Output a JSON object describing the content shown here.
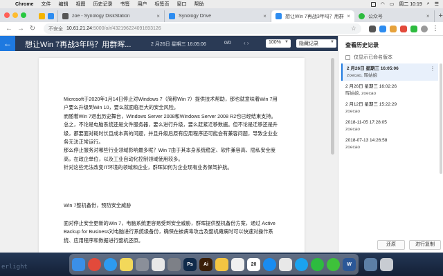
{
  "menubar": {
    "app_name": "Chrome",
    "items": [
      "文件",
      "编辑",
      "视图",
      "历史记录",
      "书签",
      "用户",
      "标签页",
      "窗口",
      "帮助"
    ],
    "clock": "周二 10:19"
  },
  "tabs": [
    {
      "title": "zoe - Synology DiskStation",
      "active": false
    },
    {
      "title": "Synology Drive",
      "active": false
    },
    {
      "title": "想让Win 7再战3年吗？用群晖让",
      "active": true
    },
    {
      "title": "公众号",
      "active": false
    }
  ],
  "address": {
    "security_label": "不安全",
    "host": "10.61.21.24",
    "path": ":5000/o/r/432196224091693126"
  },
  "doc": {
    "title": "想让Win 7再战3年吗？用群晖...",
    "date": "2 月26日 星期三 16:05:06",
    "page_indicator": "0/0",
    "zoom": "100%",
    "hide_option": "隐藏记录",
    "paragraphs": [
      "Microsoft于2020年1月14日停止对Windows 7（简称Win 7）提供技术帮助，那也就意味着Win 7用户要么升级到Win 10，要么就面临巨大的安全风险。",
      "而随着Win 7退出历史舞台，Windows Server 2008和Windows Server 2008 R2也已经结束支持。",
      "总之，不论是电脑系统还是文件服务器，要么进行升级，要么赶紧迁移数据。但不论是迁移还是升级，都要面对耗时长且成本高的问题，并且升级后原有应用程序还可能会有兼容问题，导致企业业务无法正常运行。",
      "那么停止服务对哪些行业领域影响最多呢？Win 7由于其本身系统稳定、软件兼容高、隐私安全度高，在政企单位，以及工业自动化控制领域使用较多。",
      "针对这些无法改变IT环境的领域和企业，群晖如何为企业现有业务保驾护航。"
    ],
    "section_heading": "Win 7整机备份，预防安全威胁",
    "section_paragraph": "面对停止安全更新的Win 7，电脑系统更容易受到安全威胁，群晖提供整机备份方案，通过 Active Backup for Business对电脑进行系统级备份，确保在被病毒攻击及整机瘫痪时可以快速对操作系统、应用程序和数据进行整机还原。"
  },
  "history": {
    "title": "查看历史记录",
    "only_named_label": "仅显示已命名版本",
    "entries": [
      {
        "date": "2 月26日 星期三 16:05:06",
        "authors": "zoecao, 晖姑娘",
        "selected": true
      },
      {
        "date": "2 月26日 星期三 16:02:26",
        "authors": "晖姑娘, zoecao",
        "selected": false
      },
      {
        "date": "2 月12日 星期三 15:22:29",
        "authors": "zoecao",
        "selected": false
      },
      {
        "date": "2018-11-05 17:28:05",
        "authors": "zoecao",
        "selected": false
      },
      {
        "date": "2018-07-13 14:26:58",
        "authors": "zoecao",
        "selected": false
      }
    ],
    "restore_label": "还原",
    "copy_label": "进行复制"
  },
  "desktop": {
    "text": "erlight"
  },
  "dock": {
    "items": [
      {
        "name": "finder-icon",
        "color": "#3b8fe8"
      },
      {
        "name": "chrome-icon",
        "color": "#e24a3b"
      },
      {
        "name": "safari-icon",
        "color": "#2d9bf0"
      },
      {
        "name": "notes-icon",
        "color": "#f2d85a"
      },
      {
        "name": "launchpad-icon",
        "color": "#8a8f99"
      },
      {
        "name": "photos-icon",
        "color": "#e8e8e8"
      },
      {
        "name": "system-preferences-icon",
        "color": "#7d8087"
      },
      {
        "name": "photoshop-icon",
        "color": "#0f2a4a",
        "glyph": "Ps"
      },
      {
        "name": "illustrator-icon",
        "color": "#3a1e08",
        "glyph": "Ai"
      },
      {
        "name": "photos-app-icon",
        "color": "#f4c542"
      },
      {
        "name": "preview-icon",
        "color": "#f0f0f0"
      },
      {
        "name": "calendar-icon",
        "color": "#ffffff",
        "glyph": "20"
      },
      {
        "name": "app-store-icon",
        "color": "#1a8cf0"
      },
      {
        "name": "text-edit-icon",
        "color": "#e8e8e8"
      },
      {
        "name": "qq-icon",
        "color": "#1aa3f0"
      },
      {
        "name": "wechat-icon",
        "color": "#2dbb3f"
      },
      {
        "name": "messages-icon",
        "color": "#3ec23a"
      },
      {
        "name": "word-icon",
        "color": "#2b5797",
        "glyph": "W"
      },
      {
        "name": "downloads-icon",
        "color": "#5c7fa6"
      },
      {
        "name": "trash-icon",
        "color": "#c8ccd2"
      }
    ]
  }
}
